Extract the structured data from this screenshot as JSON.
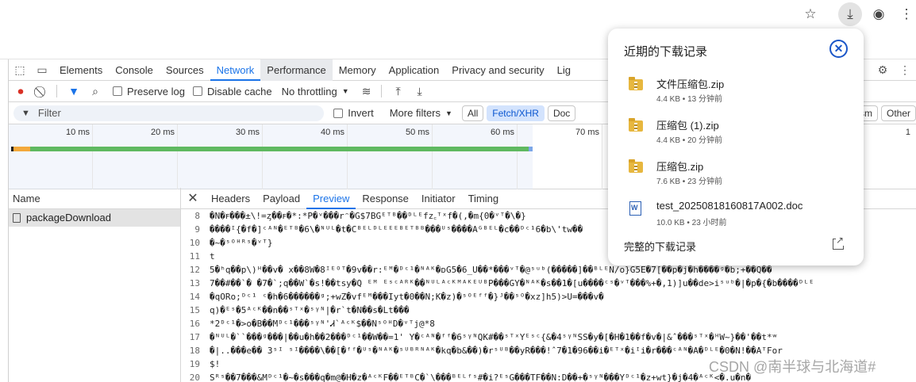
{
  "browser": {
    "icons": [
      "bookmark-star-icon",
      "download-icon",
      "account-icon",
      "menu-kebab-icon"
    ]
  },
  "devtools": {
    "tabs": [
      "Elements",
      "Console",
      "Sources",
      "Network",
      "Performance",
      "Memory",
      "Application",
      "Privacy and security",
      "Lig"
    ],
    "active_tab": "Network",
    "toolbar": {
      "preserve_log": "Preserve log",
      "disable_cache": "Disable cache",
      "throttling": "No throttling"
    },
    "filter": {
      "placeholder": "Filter",
      "invert": "Invert",
      "more_filters": "More filters",
      "chips": [
        "All",
        "Fetch/XHR",
        "Doc"
      ],
      "right_chips": [
        "asm",
        "Other"
      ]
    },
    "timeline": {
      "ticks": [
        "10 ms",
        "20 ms",
        "30 ms",
        "40 ms",
        "50 ms",
        "60 ms",
        "70 ms",
        "1"
      ]
    },
    "requests": {
      "header": "Name",
      "items": [
        "packageDownload"
      ]
    },
    "detail": {
      "tabs": [
        "Headers",
        "Payload",
        "Preview",
        "Response",
        "Initiator",
        "Timing"
      ],
      "active_tab": "Preview",
      "lines": [
        {
          "n": "8",
          "t": "�N�ꜰ���±\\!=ᶎ��ꜰ�*:*P�ᵛ���rᵔ�G$7BGᴱᵀᴮ��ᴰᴸᴱfz꜀ᵀˣf�(,�m{0�ᵛᵀ�\\�}"
        },
        {
          "n": "9",
          "t": "����ᴵ{�f�]ᶜᴬᴺ�ᴱᵀᴮ�6\\�ᴺᵁᴸ�t�Cᴮᴱᴸᴰᴸᴱᴱᴱᴮᴱᵀᴮᴮ���ᵁˢ����Aᴳᴮᴱᴸ�c��ᴰᶜ¹6�b\\'tw��"
        },
        {
          "n": "10",
          "t": "�~�ˢᴼᴴᴿˢ�ᵛᵀ}"
        },
        {
          "n": "11",
          "t": "t"
        },
        {
          "n": "12",
          "t": "5�ʰq��p\\)ᴴ��v�  x��8W�8ᴵᴱᴼᵀ�9v��r꞉ᴱᴹ�ᴰᶜ¹�ᴺᴬᴷ�ᴅG5�6_U��*���ᵛᵀ�@ˢᵘᵇ(�����]��ᴮᴸᴱN/o}G5E�7[��p�j�h����ᵍ�b;+��Q��"
        },
        {
          "n": "13",
          "t": "7��#��`�   �7�`;q��W`�s!��tsy�Q ᴱᴹ ᴱˢᶜᴬᴿᴷ��ᴺᵁᴸᴬᶜᴷᴹᴬᴷᴱᵁᴮP���GY�ᴺᴬᴷ�s��1�[u����ᶜˢ�ᵛᵀ���%+�,1)]u��de>iˢᵘᵇ�|�p�{�b����ᴰᴸᴱ"
        },
        {
          "n": "14",
          "t": "�qORo;ᴰᶜ¹ ᶜ�h�6������ᵍ;+wZ�vfᴱᴹ���Iyt�0��N;K�z)�ˢᴼᴱᶠᶠ�}ᴶ��ˢᴼ�xz]h5)>U=���v�"
        },
        {
          "n": "15",
          "t": "q)�ᴱˢ�5ᴬᶜᴷ��n��ˢᵀˣ�ˢᵞᴺ|�r`t�N��s�Lt���"
        },
        {
          "n": "16",
          "t": "*2ᴰᶜ¹�>o�B��Mᴰᶜ¹���ˢᵞᴺ'Ꮧ`ᴬᶜᴷ$��NˢᴼᴴD�ᵛᵀj@*8"
        },
        {
          "n": "17",
          "t": "�ᴺᵁᴸ�``���ᵍ���|��u�h��2���ᴰᶜ¹��W��=1' Y�ᶜᴬᴺ�ᶠᶠ�6ˢᵞᴺQK#��ˢᵀˣYᴱˢᶜ{&�4ˢᵞᴺSS�y�[�H�1��f�v�|&ˆ���ˢᵀˣ�ᴴW~}��'��t*ʷ"
        },
        {
          "n": "18",
          "t": "�|..���e��   3ˢᴵ ˢᴵ����\\��[�ᶠᶠ�ᵁˢ�ᴺᴬᴷ�ˢᵁᴮᴿᴺᴬᴷ�kq�b&��)�rˢᵁᴮ��yR���!ˆ7�1�96��i�ᴱᵀˣ�iᴵi�r���ᶜᴬᴺ�A�ᴰᴸᴱ�0�N!��AᵀFor"
        },
        {
          "n": "19",
          "t": "$!"
        },
        {
          "n": "20",
          "t": "Sᴿˢ��7���&Mᴰᶜ¹�~�s���q�m@�H�z�ᴬᶜᴷF��ᴱᵀᴮC�`\\���ᴮᴱᴸᶠˢ#�i?ᴱˢG���TF��N:D��+�ˢᵞᴺ���Yᴰᶜ¹�z+wt}�j�4�ᴬᶜᴷ<�.u�n�"
        }
      ]
    }
  },
  "downloads": {
    "title": "近期的下载记录",
    "items": [
      {
        "name": "文件压缩包.zip",
        "meta": "4.4 KB • 13 分钟前",
        "type": "zip"
      },
      {
        "name": "压缩包 (1).zip",
        "meta": "4.4 KB • 20 分钟前",
        "type": "zip"
      },
      {
        "name": "压缩包.zip",
        "meta": "7.6 KB • 23 分钟前",
        "type": "zip"
      },
      {
        "name": "test_20250818160817A002.doc",
        "meta": "10.0 KB • 23 小时前",
        "type": "doc"
      }
    ],
    "footer": "完整的下载记录"
  },
  "watermark": "CSDN @南半球与北海道#"
}
